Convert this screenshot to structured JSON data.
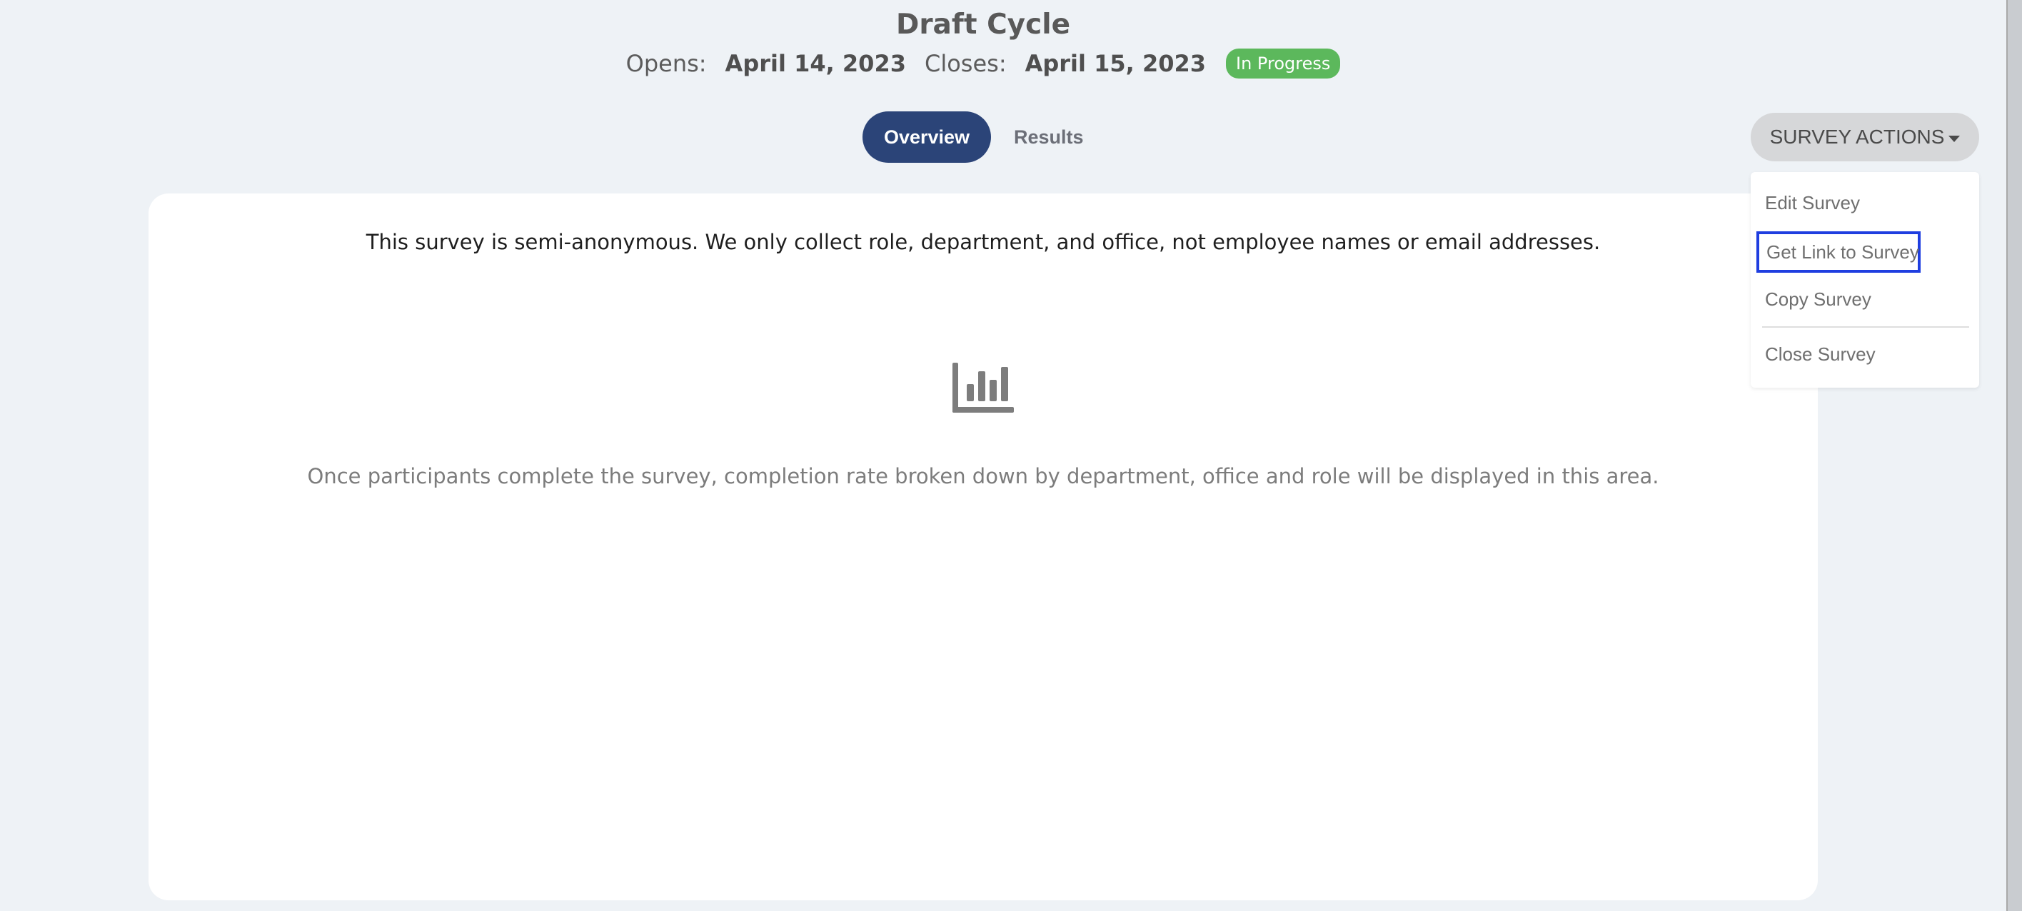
{
  "header": {
    "title": "Draft Cycle",
    "opens_label": "Opens:",
    "opens_date": "April 14, 2023",
    "closes_label": "Closes:",
    "closes_date": "April 15, 2023",
    "status_badge": "In Progress",
    "status_color": "#5cb85c"
  },
  "tabs": [
    {
      "label": "Overview",
      "active": true
    },
    {
      "label": "Results",
      "active": false
    }
  ],
  "actions": {
    "button_label": "SURVEY ACTIONS",
    "menu": {
      "edit": "Edit Survey",
      "get_link": "Get Link to Survey",
      "copy": "Copy Survey",
      "close": "Close Survey"
    }
  },
  "main": {
    "notice": "This survey is semi-anonymous. We only collect role, department, and office, not employee names or email addresses.",
    "empty_icon": "bar-chart-icon",
    "empty_message": "Once participants complete the survey, completion rate broken down by department, office and role will be displayed in this area."
  },
  "colors": {
    "accent": "#2b4478",
    "background": "#eef2f6",
    "highlight_border": "#1f3ee0"
  }
}
